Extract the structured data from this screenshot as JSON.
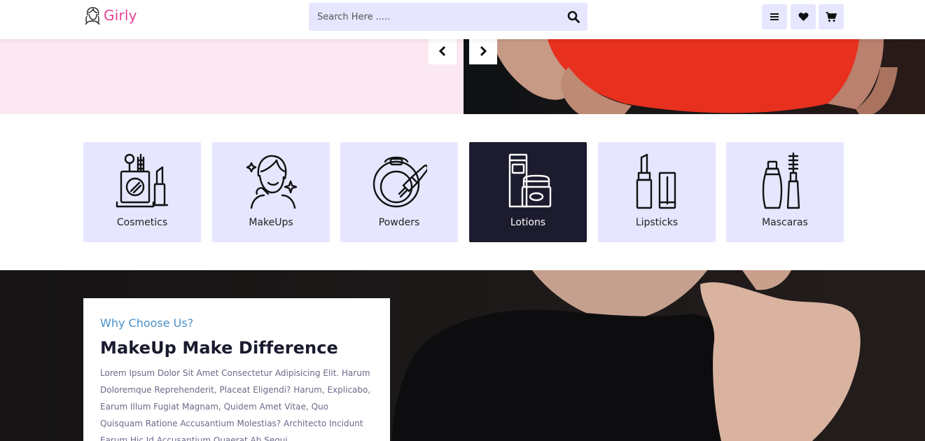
{
  "header": {
    "brand": "Girly",
    "search_placeholder": "Search Here .....",
    "icons": [
      "search-icon",
      "menu-icon",
      "heart-icon",
      "cart-icon"
    ]
  },
  "hero": {
    "prev_icon": "chevron-left-icon",
    "next_icon": "chevron-right-icon"
  },
  "categories": [
    {
      "label": "Cosmetics",
      "icon": "cosmetics-icon"
    },
    {
      "label": "MakeUps",
      "icon": "makeup-face-icon"
    },
    {
      "label": "Powders",
      "icon": "powder-compact-icon"
    },
    {
      "label": "Lotions",
      "icon": "lotion-icon",
      "active": true
    },
    {
      "label": "Lipsticks",
      "icon": "lipstick-icon"
    },
    {
      "label": "Mascaras",
      "icon": "mascara-icon"
    }
  ],
  "why": {
    "kicker": "Why Choose Us?",
    "title": "MakeUp Make Difference",
    "body": "Lorem Ipsum Dolor Sit Amet Consectetur Adipisicing Elit. Harum Doloremque Reprehenderit, Placeat Eligendi? Harum, Explicabo, Earum Illum Fugiat Magnam, Quidem Amet Vitae, Quo Quisquam Ratione Accusantium Molestias? Architecto Incidunt Earum Hic Id Accusantium Quaerat Ab Sequi."
  },
  "colors": {
    "brand_pink": "#e84393",
    "accent_lavender": "#e6e6ff",
    "active_dark": "#1c1c2e",
    "hero_pink": "#fce8f1",
    "kicker_blue": "#4a90c8"
  }
}
